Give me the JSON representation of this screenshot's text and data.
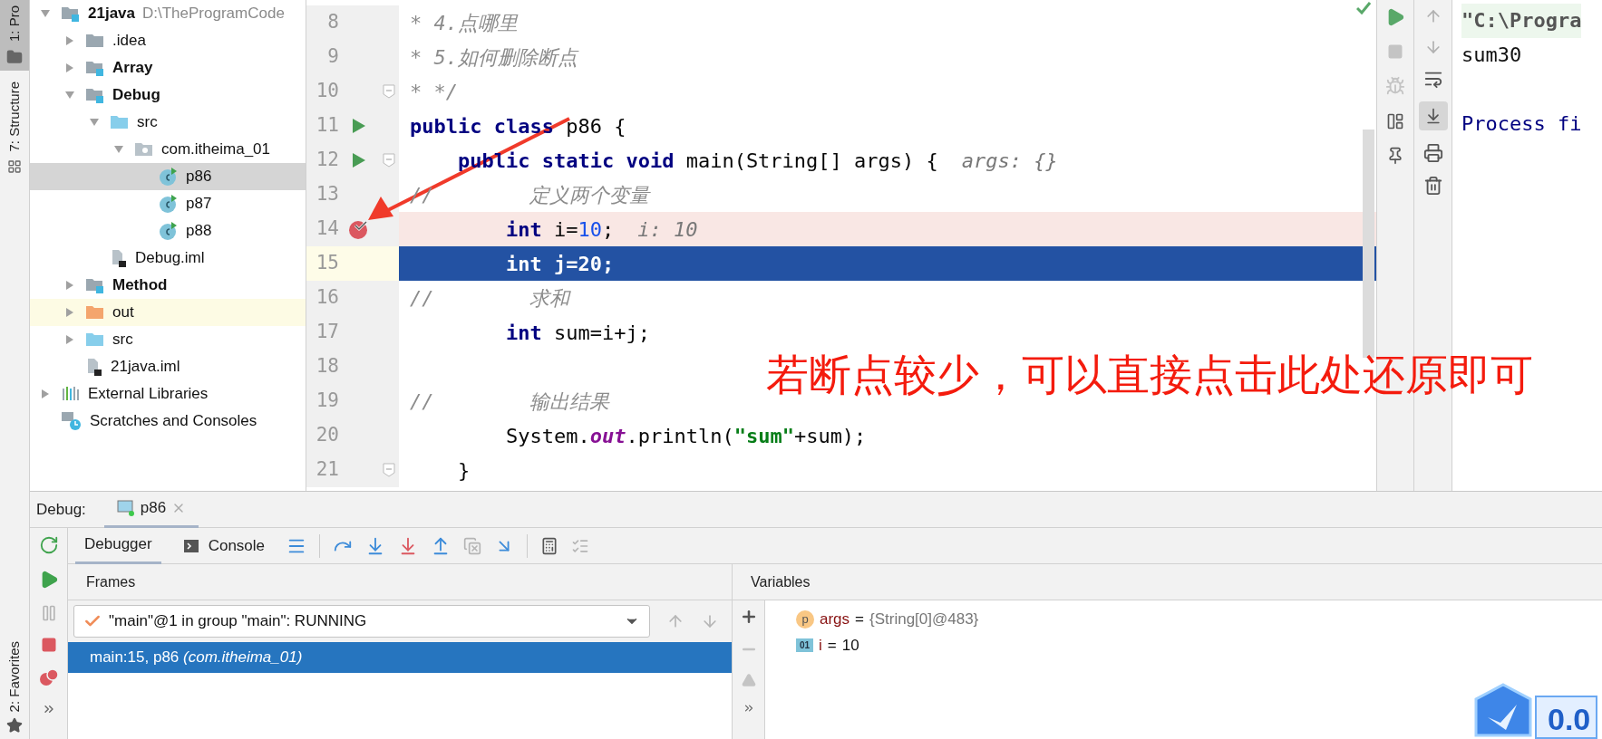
{
  "tool_strip_left": {
    "top_tabs": [
      {
        "label": "1: Pro",
        "selected": true
      },
      {
        "label": "7: Structure",
        "selected": false
      }
    ],
    "bottom_tabs": [
      {
        "label": "2: Favorites",
        "selected": false
      }
    ]
  },
  "project_tree": [
    {
      "name": "21java",
      "path": "D:\\TheProgramCode",
      "kind": "module",
      "expanded": true,
      "selected": false,
      "children": [
        {
          "name": ".idea",
          "kind": "folder",
          "expanded": false,
          "selected": false
        },
        {
          "name": "Array",
          "kind": "module",
          "expanded": false,
          "selected": false
        },
        {
          "name": "Debug",
          "kind": "module",
          "expanded": true,
          "selected": false,
          "children": [
            {
              "name": "src",
              "kind": "source_folder",
              "expanded": true,
              "selected": false,
              "children": [
                {
                  "name": "com.itheima_01",
                  "kind": "package",
                  "expanded": true,
                  "selected": false,
                  "children": [
                    {
                      "name": "p86",
                      "kind": "class",
                      "selected": true
                    },
                    {
                      "name": "p87",
                      "kind": "class",
                      "selected": false
                    },
                    {
                      "name": "p88",
                      "kind": "class",
                      "selected": false
                    }
                  ]
                }
              ]
            },
            {
              "name": "Debug.iml",
              "kind": "iml",
              "selected": false
            }
          ]
        },
        {
          "name": "Method",
          "kind": "module",
          "expanded": false,
          "selected": false
        },
        {
          "name": "out",
          "kind": "excluded_folder",
          "expanded": false,
          "selected": false
        },
        {
          "name": "src",
          "kind": "source_folder",
          "expanded": false,
          "selected": false
        },
        {
          "name": "21java.iml",
          "kind": "iml",
          "selected": false
        }
      ]
    },
    {
      "name": "External Libraries",
      "kind": "libraries",
      "expanded": false,
      "selected": false
    },
    {
      "name": "Scratches and Consoles",
      "kind": "scratches",
      "selected": false
    }
  ],
  "editor": {
    "lines": [
      {
        "number": "8",
        "runnable": false,
        "breakpoint": false,
        "executing": false,
        "fold": false,
        "segments": [
          {
            "kind": "comment",
            "text": "* 4.点哪里"
          }
        ]
      },
      {
        "number": "9",
        "runnable": false,
        "breakpoint": false,
        "executing": false,
        "fold": false,
        "segments": [
          {
            "kind": "comment",
            "text": "* 5.如何删除断点"
          }
        ]
      },
      {
        "number": "10",
        "runnable": false,
        "breakpoint": false,
        "executing": false,
        "fold": true,
        "segments": [
          {
            "kind": "comment",
            "text": "* */"
          }
        ]
      },
      {
        "number": "11",
        "runnable": true,
        "breakpoint": false,
        "executing": false,
        "fold": false,
        "segments": [
          {
            "kind": "keyword",
            "text": "public class"
          },
          {
            "kind": "plain",
            "text": " p86 {"
          }
        ]
      },
      {
        "number": "12",
        "runnable": true,
        "breakpoint": false,
        "executing": false,
        "fold": true,
        "segments": [
          {
            "kind": "keyword",
            "text": "    public static void"
          },
          {
            "kind": "plain",
            "text": " main(String[] args) {"
          },
          {
            "kind": "hint",
            "text": "args: {}"
          }
        ]
      },
      {
        "number": "13",
        "runnable": false,
        "breakpoint": false,
        "executing": false,
        "fold": false,
        "segments": [
          {
            "kind": "comment",
            "text": "//        定义两个变量"
          }
        ]
      },
      {
        "number": "14",
        "runnable": false,
        "breakpoint": true,
        "executing": false,
        "fold": false,
        "segments": [
          {
            "kind": "keyword",
            "text": "        int"
          },
          {
            "kind": "plain",
            "text": " i="
          },
          {
            "kind": "number",
            "text": "10"
          },
          {
            "kind": "plain",
            "text": ";"
          },
          {
            "kind": "hint",
            "text": "i: 10"
          }
        ]
      },
      {
        "number": "15",
        "runnable": false,
        "breakpoint": false,
        "executing": true,
        "fold": false,
        "segments": [
          {
            "kind": "keyword",
            "text": "        int"
          },
          {
            "kind": "plain",
            "text": " j="
          },
          {
            "kind": "number",
            "text": "20"
          },
          {
            "kind": "plain",
            "text": ";"
          }
        ]
      },
      {
        "number": "16",
        "runnable": false,
        "breakpoint": false,
        "executing": false,
        "fold": false,
        "segments": [
          {
            "kind": "comment",
            "text": "//        求和"
          }
        ]
      },
      {
        "number": "17",
        "runnable": false,
        "breakpoint": false,
        "executing": false,
        "fold": false,
        "segments": [
          {
            "kind": "keyword",
            "text": "        int"
          },
          {
            "kind": "plain",
            "text": " sum=i+j;"
          }
        ]
      },
      {
        "number": "18",
        "runnable": false,
        "breakpoint": false,
        "executing": false,
        "fold": false
      },
      {
        "number": "19",
        "runnable": false,
        "breakpoint": false,
        "executing": false,
        "fold": false,
        "segments": [
          {
            "kind": "comment",
            "text": "//        输出结果"
          }
        ]
      },
      {
        "number": "20",
        "runnable": false,
        "breakpoint": false,
        "executing": false,
        "fold": false,
        "segments": [
          {
            "kind": "plain",
            "text": "        System."
          },
          {
            "kind": "field",
            "text": "out"
          },
          {
            "kind": "plain",
            "text": ".println("
          },
          {
            "kind": "string",
            "text": "\"sum\""
          },
          {
            "kind": "plain",
            "text": "+sum);"
          }
        ]
      },
      {
        "number": "21",
        "runnable": false,
        "breakpoint": false,
        "executing": false,
        "fold": true,
        "segments": [
          {
            "kind": "plain",
            "text": "    }"
          }
        ]
      }
    ]
  },
  "console": {
    "lines": [
      {
        "kind": "command",
        "text": "\"C:\\Progra"
      },
      {
        "kind": "output",
        "text": "sum30"
      },
      {
        "kind": "status",
        "text": "Process fi"
      }
    ]
  },
  "annotation": {
    "text": "若断点较少，可以直接点击此处还原即可"
  },
  "debug": {
    "label": "Debug:",
    "session_tab": {
      "title": "p86",
      "selected": true
    },
    "tabs": [
      {
        "label": "Debugger",
        "kind": "debugger",
        "selected": true
      },
      {
        "label": "Console",
        "kind": "console",
        "selected": false
      }
    ],
    "frames": {
      "title": "Frames",
      "thread": "\"main\"@1 in group \"main\": RUNNING",
      "items": [
        {
          "text": "main:15, p86 *(com.itheima_01)*",
          "selected": true
        }
      ]
    },
    "variables": {
      "title": "Variables",
      "items": [
        {
          "badge": "p",
          "kind": "parameter",
          "name": "args",
          "operator": "=",
          "value": "{String[0]@483}"
        },
        {
          "badge": "01",
          "kind": "primitive",
          "name": "i",
          "operator": "=",
          "value": "10"
        }
      ]
    }
  },
  "speed_widget": {
    "text": "0.0"
  }
}
